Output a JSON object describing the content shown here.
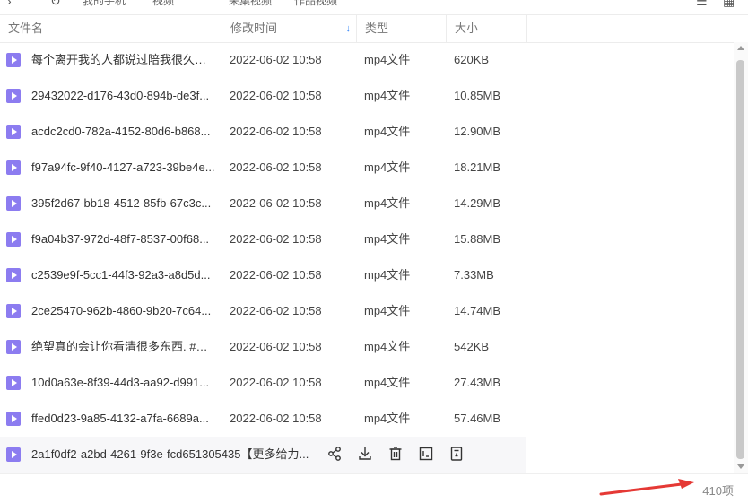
{
  "topbar": {
    "crumbs": [
      "我的手机",
      "视频",
      "采集视频",
      "作品视频"
    ]
  },
  "columns": {
    "name": "文件名",
    "modified": "修改时间",
    "sort_indicator": "↓",
    "type": "类型",
    "size": "大小"
  },
  "rows": [
    {
      "name": "每个离开我的人都说过陪我很久很久...",
      "date": "2022-06-02 10:58",
      "type": "mp4文件",
      "size": "620KB"
    },
    {
      "name": "29432022-d176-43d0-894b-de3f...",
      "date": "2022-06-02 10:58",
      "type": "mp4文件",
      "size": "10.85MB"
    },
    {
      "name": "acdc2cd0-782a-4152-80d6-b868...",
      "date": "2022-06-02 10:58",
      "type": "mp4文件",
      "size": "12.90MB"
    },
    {
      "name": "f97a94fc-9f40-4127-a723-39be4e...",
      "date": "2022-06-02 10:58",
      "type": "mp4文件",
      "size": "18.21MB"
    },
    {
      "name": "395f2d67-bb18-4512-85fb-67c3c...",
      "date": "2022-06-02 10:58",
      "type": "mp4文件",
      "size": "14.29MB"
    },
    {
      "name": "f9a04b37-972d-48f7-8537-00f68...",
      "date": "2022-06-02 10:58",
      "type": "mp4文件",
      "size": "15.88MB"
    },
    {
      "name": "c2539e9f-5cc1-44f3-92a3-a8d5d...",
      "date": "2022-06-02 10:58",
      "type": "mp4文件",
      "size": "7.33MB"
    },
    {
      "name": "2ce25470-962b-4860-9b20-7c64...",
      "date": "2022-06-02 10:58",
      "type": "mp4文件",
      "size": "14.74MB"
    },
    {
      "name": "绝望真的会让你看清很多东西. #我...",
      "date": "2022-06-02 10:58",
      "type": "mp4文件",
      "size": "542KB"
    },
    {
      "name": "10d0a63e-8f39-44d3-aa92-d991...",
      "date": "2022-06-02 10:58",
      "type": "mp4文件",
      "size": "27.43MB"
    },
    {
      "name": "ffed0d23-9a85-4132-a7fa-6689a...",
      "date": "2022-06-02 10:58",
      "type": "mp4文件",
      "size": "57.46MB"
    }
  ],
  "hover_row": {
    "name": "2a1f0df2-a2bd-4261-9f3e-fcd651305435【更多给力...",
    "actions": [
      "share-icon",
      "download-icon",
      "delete-icon",
      "rename-icon",
      "details-icon"
    ]
  },
  "footer": {
    "count": "410项"
  },
  "colors": {
    "file_icon": "#8c7cf0",
    "sort_accent": "#3d8af7",
    "annotation_arrow": "#e53935"
  }
}
